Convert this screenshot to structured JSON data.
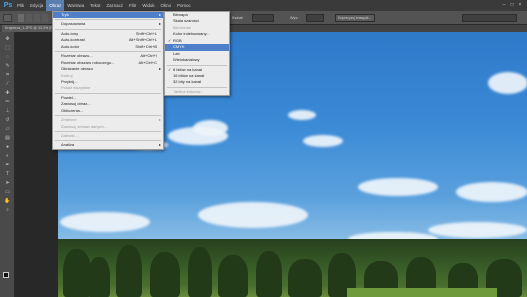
{
  "app": {
    "logo": "Ps"
  },
  "menubar": {
    "items": [
      "Plik",
      "Edycja",
      "Obraz",
      "Warstwa",
      "Tekst",
      "Zaznacz",
      "Filtr",
      "Widok",
      "Okno",
      "Pomoc"
    ],
    "active_index": 2
  },
  "document": {
    "tab_title": "Krajobraz_1.JPG @ 33,3% (RGB/8)"
  },
  "options_bar": {
    "label1": "Kształ:",
    "label2": "Wys.:",
    "label3": "Doprecyzuj krawędź..."
  },
  "image_menu": {
    "items": [
      {
        "label": "Tryb",
        "shortcut": "",
        "submenu": true,
        "disabled": false,
        "highlight": true
      },
      {
        "sep": true
      },
      {
        "label": "Dopasowania",
        "shortcut": "",
        "submenu": true,
        "disabled": false
      },
      {
        "sep": true
      },
      {
        "label": "Auto-tony",
        "shortcut": "Shift+Ctrl+L",
        "disabled": false
      },
      {
        "label": "Auto-kontrast",
        "shortcut": "Alt+Shift+Ctrl+L",
        "disabled": false
      },
      {
        "label": "Auto-kolor",
        "shortcut": "Shift+Ctrl+B",
        "disabled": false
      },
      {
        "sep": true
      },
      {
        "label": "Rozmiar obrazu...",
        "shortcut": "Alt+Ctrl+I",
        "disabled": false
      },
      {
        "label": "Rozmiar obszaru roboczego...",
        "shortcut": "Alt+Ctrl+C",
        "disabled": false
      },
      {
        "label": "Obracanie obrazu",
        "shortcut": "",
        "submenu": true,
        "disabled": false
      },
      {
        "label": "Kadruj",
        "shortcut": "",
        "disabled": true
      },
      {
        "label": "Przytnij...",
        "shortcut": "",
        "disabled": false
      },
      {
        "label": "Pokaż wszystkie",
        "shortcut": "",
        "disabled": true
      },
      {
        "sep": true
      },
      {
        "label": "Powiel...",
        "shortcut": "",
        "disabled": false
      },
      {
        "label": "Zastosuj obraz...",
        "shortcut": "",
        "disabled": false
      },
      {
        "label": "Obliczenia...",
        "shortcut": "",
        "disabled": false
      },
      {
        "sep": true
      },
      {
        "label": "Zmienne",
        "shortcut": "",
        "submenu": true,
        "disabled": true
      },
      {
        "label": "Zastosuj zestaw danych...",
        "shortcut": "",
        "disabled": true
      },
      {
        "sep": true
      },
      {
        "label": "Zalewki...",
        "shortcut": "",
        "disabled": true
      },
      {
        "sep": true
      },
      {
        "label": "Analiza",
        "shortcut": "",
        "submenu": true,
        "disabled": false
      }
    ]
  },
  "mode_submenu": {
    "items": [
      {
        "label": "Bitmapa",
        "disabled": false,
        "checked": false
      },
      {
        "label": "Skala szarości",
        "disabled": false,
        "checked": false
      },
      {
        "label": "Bichromia",
        "disabled": true,
        "checked": false
      },
      {
        "label": "Kolor indeksowany...",
        "disabled": false,
        "checked": false
      },
      {
        "label": "RGB",
        "disabled": false,
        "checked": true
      },
      {
        "label": "CMYK",
        "disabled": false,
        "checked": false,
        "highlight": true
      },
      {
        "label": "Lab",
        "disabled": false,
        "checked": false
      },
      {
        "label": "Wielokanałowy",
        "disabled": false,
        "checked": false
      },
      {
        "sep": true
      },
      {
        "label": "8 bitów na kanał",
        "disabled": false,
        "checked": true
      },
      {
        "label": "16 bitów na kanał",
        "disabled": false,
        "checked": false
      },
      {
        "label": "32 bity na kanał",
        "disabled": false,
        "checked": false
      },
      {
        "sep": true
      },
      {
        "label": "Tablica kolorów...",
        "disabled": true,
        "checked": false
      }
    ]
  },
  "tools": [
    "move",
    "marquee",
    "lasso",
    "quick-select",
    "crop",
    "eyedropper",
    "healing",
    "brush",
    "stamp",
    "history-brush",
    "eraser",
    "gradient",
    "blur",
    "dodge",
    "pen",
    "type",
    "path-select",
    "shape",
    "hand",
    "zoom"
  ],
  "colors": {
    "accent": "#4f7fc8",
    "menu_bg": "#ececec",
    "ui_dark": "#3a3a3a"
  }
}
